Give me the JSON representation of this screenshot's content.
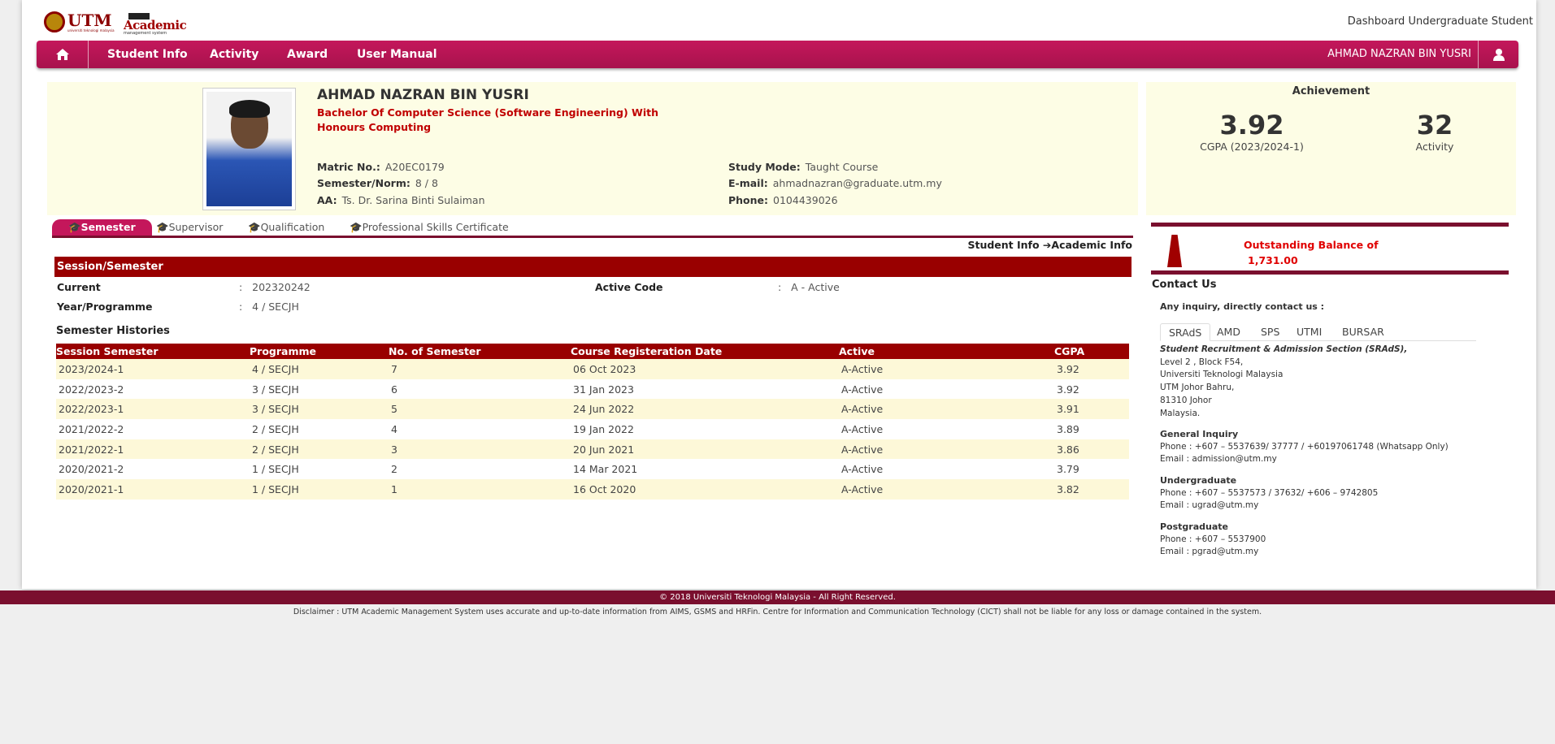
{
  "header": {
    "logo_utm": "UTM",
    "logo_utm_sub": "universiti teknologi malaysia",
    "logo_am": "Academic",
    "logo_am_sub": "management system",
    "dashboard_title": "Dashboard Undergraduate Student"
  },
  "nav": {
    "home_icon": "home-icon",
    "items": [
      "Student Info",
      "Activity",
      "Award",
      "User Manual"
    ],
    "user_name": "AHMAD NAZRAN BIN YUSRI",
    "user_icon": "user-icon"
  },
  "profile": {
    "name": "AHMAD NAZRAN BIN YUSRI",
    "programme": "Bachelor Of Computer Science (Software Engineering) With Honours Computing",
    "matric_label": "Matric No.:",
    "matric": "A20EC0179",
    "semester_label": "Semester/Norm:",
    "semester": "8 / 8",
    "aa_label": "AA:",
    "aa": "Ts. Dr. Sarina Binti Sulaiman",
    "study_mode_label": "Study Mode:",
    "study_mode": "Taught Course",
    "email_label": "E-mail:",
    "email": "ahmadnazran@graduate.utm.my",
    "phone_label": "Phone:",
    "phone": "0104439026"
  },
  "achievement": {
    "title": "Achievement",
    "cgpa": "3.92",
    "cgpa_label": "CGPA (2023/2024-1)",
    "activity": "32",
    "activity_label": "Activity"
  },
  "tabs": [
    "Semester",
    "Supervisor",
    "Qualification",
    "Professional Skills Certificate"
  ],
  "breadcrumb": "Student Info ➔Academic Info",
  "session": {
    "header": "Session/Semester",
    "current_label": "Current",
    "current": "202320242",
    "year_label": "Year/Programme",
    "year": "4 / SECJH",
    "active_label": "Active Code",
    "active": "A - Active",
    "sep": ":"
  },
  "history": {
    "title": "Semester Histories",
    "columns": [
      "Session Semester",
      "Programme",
      "No. of Semester",
      "Course Registeration Date",
      "Active",
      "CGPA"
    ],
    "rows": [
      [
        "2023/2024-1",
        "4 / SECJH",
        "7",
        "06 Oct 2023",
        "A-Active",
        "3.92"
      ],
      [
        "2022/2023-2",
        "3 / SECJH",
        "6",
        "31 Jan 2023",
        "A-Active",
        "3.92"
      ],
      [
        "2022/2023-1",
        "3 / SECJH",
        "5",
        "24 Jun 2022",
        "A-Active",
        "3.91"
      ],
      [
        "2021/2022-2",
        "2 / SECJH",
        "4",
        "19 Jan 2022",
        "A-Active",
        "3.89"
      ],
      [
        "2021/2022-1",
        "2 / SECJH",
        "3",
        "20 Jun 2021",
        "A-Active",
        "3.86"
      ],
      [
        "2020/2021-2",
        "1 / SECJH",
        "2",
        "14 Mar 2021",
        "A-Active",
        "3.79"
      ],
      [
        "2020/2021-1",
        "1 / SECJH",
        "1",
        "16 Oct 2020",
        "A-Active",
        "3.82"
      ]
    ]
  },
  "balance": {
    "label": "Outstanding Balance of",
    "amount": "1,731.00"
  },
  "contact": {
    "title": "Contact Us",
    "note": "Any inquiry, directly contact us :",
    "tabs": [
      "SRAdS",
      "AMD",
      "SPS",
      "UTMI",
      "BURSAR"
    ],
    "org": "Student Recruitment & Admission Section (SRAdS),",
    "address": [
      "Level 2 , Block F54,",
      "Universiti Teknologi Malaysia",
      "UTM Johor Bahru,",
      "81310 Johor",
      "Malaysia."
    ],
    "general_title": "General Inquiry",
    "general_phone": "Phone : +607 – 5537639/ 37777 / +60197061748 (Whatsapp Only)",
    "general_email": "Email : admission@utm.my",
    "ug_title": "Undergraduate",
    "ug_phone": "Phone : +607 – 5537573 / 37632/ +606 – 9742805",
    "ug_email": "Email : ugrad@utm.my",
    "pg_title": "Postgraduate",
    "pg_phone": "Phone : +607 – 5537900",
    "pg_email": "Email : pgrad@utm.my"
  },
  "footer": {
    "copyright": "© 2018 Universiti Teknologi Malaysia - All Right Reserved.",
    "disclaimer": "Disclaimer : UTM Academic Management System uses accurate and up-to-date information from AIMS, GSMS and HRFin. Centre for Information and Communication Technology (CICT) shall not be liable for any loss or damage contained in the system."
  },
  "colors": {
    "nav": "#c4175b",
    "maroon": "#990000",
    "dark_maroon": "#7a0f2e",
    "panel_bg": "#fdfde5",
    "alert": "#e00000"
  }
}
